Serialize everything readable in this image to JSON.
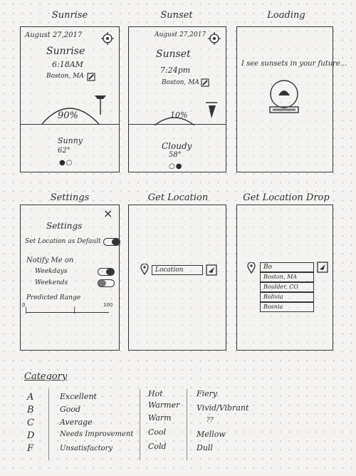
{
  "sunrise": {
    "title": "Sunrise",
    "date": "August 27,2017",
    "event": "Sunrise",
    "time": "6:18AM",
    "location": "Boston, MA",
    "percent": "90%",
    "condition": "Sunny",
    "temp": "62°"
  },
  "sunset": {
    "title": "Sunset",
    "date": "August 27,2017",
    "event": "Sunset",
    "time": "7:24pm",
    "location": "Boston, MA",
    "percent": "10%",
    "condition": "Cloudy",
    "temp": "58°"
  },
  "loading": {
    "title": "Loading",
    "message": "I see sunsets in your future..."
  },
  "settings": {
    "title": "Settings",
    "heading": "Settings",
    "close": "×",
    "default_location": "Set Location as Default",
    "notify": "Notify Me on",
    "weekdays": "Weekdays",
    "weekends": "Weekends",
    "range_label": "Predicted Range",
    "range_min": "0",
    "range_max": "100"
  },
  "get_location": {
    "title": "Get Location",
    "placeholder": "Location"
  },
  "get_location_drop": {
    "title": "Get Location Drop",
    "query": "Bo",
    "options": [
      "Boston, MA",
      "Boulder, CO",
      "Bolivia",
      "Bosnia"
    ]
  },
  "category": {
    "title": "Category",
    "letters": [
      "A",
      "B",
      "C",
      "D",
      "F"
    ],
    "ratings": [
      "Excellent",
      "Good",
      "Average",
      "Needs Improvement",
      "Unsatisfactory"
    ],
    "temps": [
      "Hot",
      "Warmer",
      "Warm",
      "Cool",
      "Cold"
    ],
    "colors": [
      "Fiery",
      "Vivid/Vibrant",
      "??",
      "Mellow",
      "Dull"
    ]
  }
}
